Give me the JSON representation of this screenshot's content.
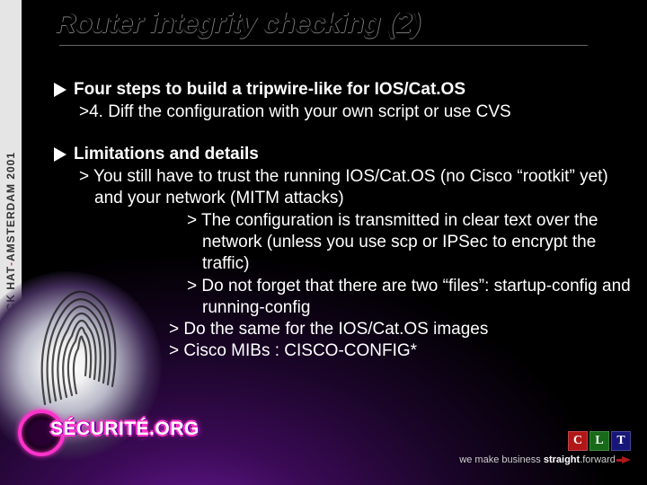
{
  "left_banner": {
    "event": "BLACK HAT",
    "dash": " - ",
    "place_year": "AMSTERDAM 2001"
  },
  "title": "Router integrity checking (2)",
  "sections": [
    {
      "heading": "Four steps to build a tripwire-like for IOS/Cat.OS",
      "items": [
        {
          "level": 2,
          "text": "4. Diff the configuration with your own script or use CVS"
        }
      ]
    },
    {
      "heading": "Limitations and details",
      "items": [
        {
          "level": 2,
          "text": "You still have to trust the running IOS/Cat.OS (no Cisco “rootkit” yet) and your network (MITM attacks)"
        },
        {
          "level": 3,
          "text": "The configuration is transmitted in clear text over the network (unless you use scp or IPSec to encrypt the traffic)"
        },
        {
          "level": 3,
          "text": "Do not forget that there are two “files”: startup-config and running-config"
        },
        {
          "level": "3b",
          "text": "Do the same for the IOS/Cat.OS images"
        },
        {
          "level": "3b",
          "text": "Cisco MIBs : CISCO-CONFIG*"
        }
      ]
    }
  ],
  "branding": {
    "securite_logo_text": "SÉCURITÉ.ORG"
  },
  "sponsor": {
    "squares": [
      "C",
      "L",
      "T"
    ],
    "tagline_prefix": "we make business ",
    "tagline_bold": "straight",
    "tagline_suffix": ".forward"
  }
}
